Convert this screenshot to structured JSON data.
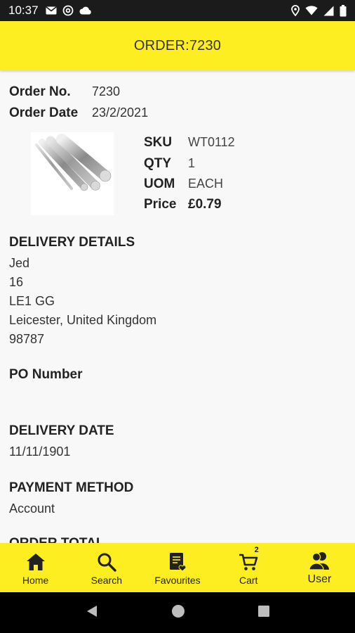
{
  "status_bar": {
    "time": "10:37",
    "left_icons": [
      "mail-icon",
      "at-sign-icon",
      "cloud-icon"
    ],
    "right_icons": [
      "location-icon",
      "wifi-icon",
      "cellular-icon",
      "battery-icon"
    ]
  },
  "header": {
    "title": "ORDER:7230"
  },
  "order": {
    "number_label": "Order No.",
    "number_value": "7230",
    "date_label": "Order Date",
    "date_value": "23/2/2021"
  },
  "item": {
    "image_icon": "steel-rods-image",
    "sku_label": "SKU",
    "sku_value": "WT0112",
    "qty_label": "QTY",
    "qty_value": "1",
    "uom_label": "UOM",
    "uom_value": "EACH",
    "price_label": "Price",
    "price_value": "£0.79"
  },
  "delivery_details": {
    "title": "DELIVERY DETAILS",
    "lines": [
      "Jed",
      "16",
      "LE1 GG",
      "Leicester, United Kingdom",
      "98787"
    ]
  },
  "po": {
    "title": "PO Number",
    "value": ""
  },
  "delivery_date": {
    "title": "DELIVERY DATE",
    "value": "11/11/1901"
  },
  "payment": {
    "title": "PAYMENT METHOD",
    "value": "Account"
  },
  "order_total": {
    "title": "ORDER TOTAL"
  },
  "bottom_nav": {
    "items": [
      {
        "label": "Home",
        "icon": "home-icon"
      },
      {
        "label": "Search",
        "icon": "search-icon"
      },
      {
        "label": "Favourites",
        "icon": "favourites-icon"
      },
      {
        "label": "Cart",
        "icon": "cart-icon",
        "badge": "2"
      },
      {
        "label": "User",
        "icon": "user-icon"
      }
    ]
  },
  "colors": {
    "accent": "#fcee21",
    "status_bar": "#1b1b1b",
    "system_nav": "#000000"
  }
}
